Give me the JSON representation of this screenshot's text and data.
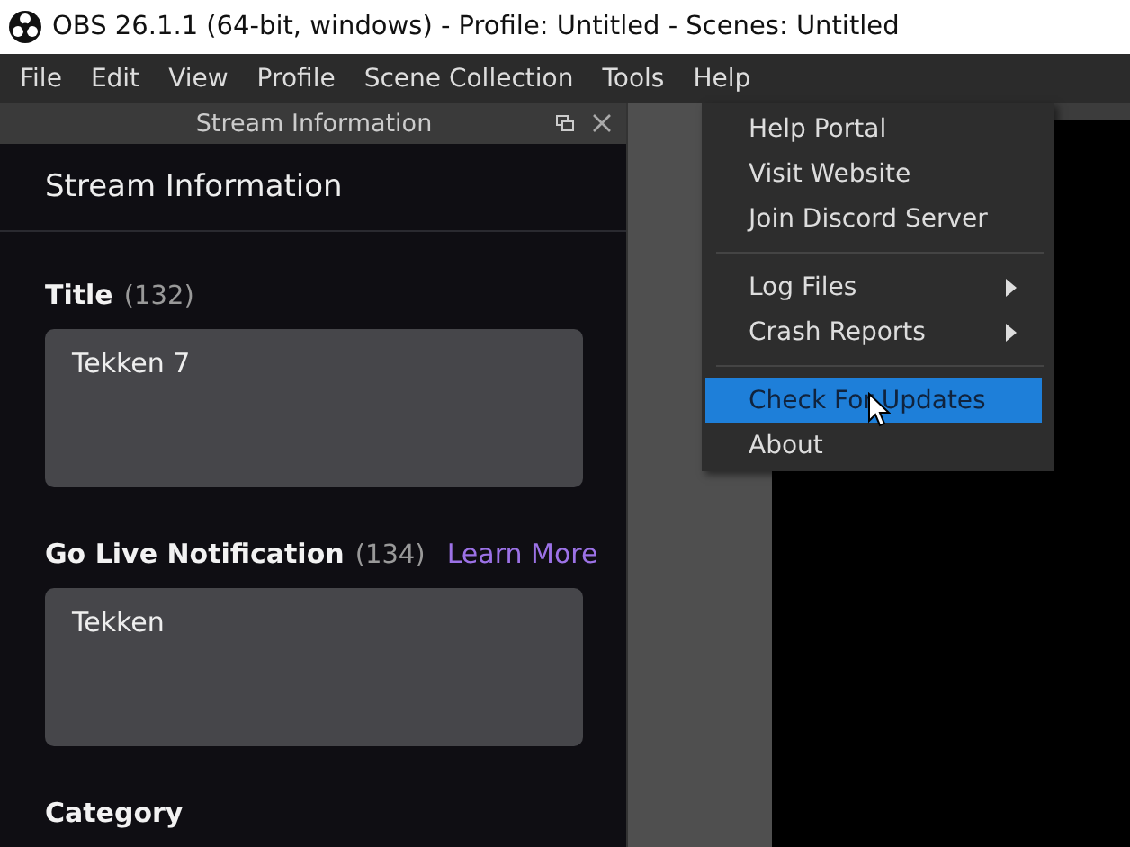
{
  "window": {
    "title": "OBS 26.1.1 (64-bit, windows) - Profile: Untitled - Scenes: Untitled"
  },
  "menubar": [
    "File",
    "Edit",
    "View",
    "Profile",
    "Scene Collection",
    "Tools",
    "Help"
  ],
  "help_menu": {
    "groups": [
      [
        {
          "label": "Help Portal",
          "has_submenu": false,
          "selected": false
        },
        {
          "label": "Visit Website",
          "has_submenu": false,
          "selected": false
        },
        {
          "label": "Join Discord Server",
          "has_submenu": false,
          "selected": false
        }
      ],
      [
        {
          "label": "Log Files",
          "has_submenu": true,
          "selected": false
        },
        {
          "label": "Crash Reports",
          "has_submenu": true,
          "selected": false
        }
      ],
      [
        {
          "label": "Check For Updates",
          "has_submenu": false,
          "selected": true
        },
        {
          "label": "About",
          "has_submenu": false,
          "selected": false
        }
      ]
    ]
  },
  "dock": {
    "title": "Stream Information",
    "heading": "Stream Information",
    "fields": [
      {
        "label": "Title",
        "count": "(132)",
        "value": "Tekken 7"
      },
      {
        "label": "Go Live Notification",
        "count": "(134)",
        "link": "Learn More",
        "value": "Tekken"
      },
      {
        "label": "Category"
      }
    ]
  }
}
